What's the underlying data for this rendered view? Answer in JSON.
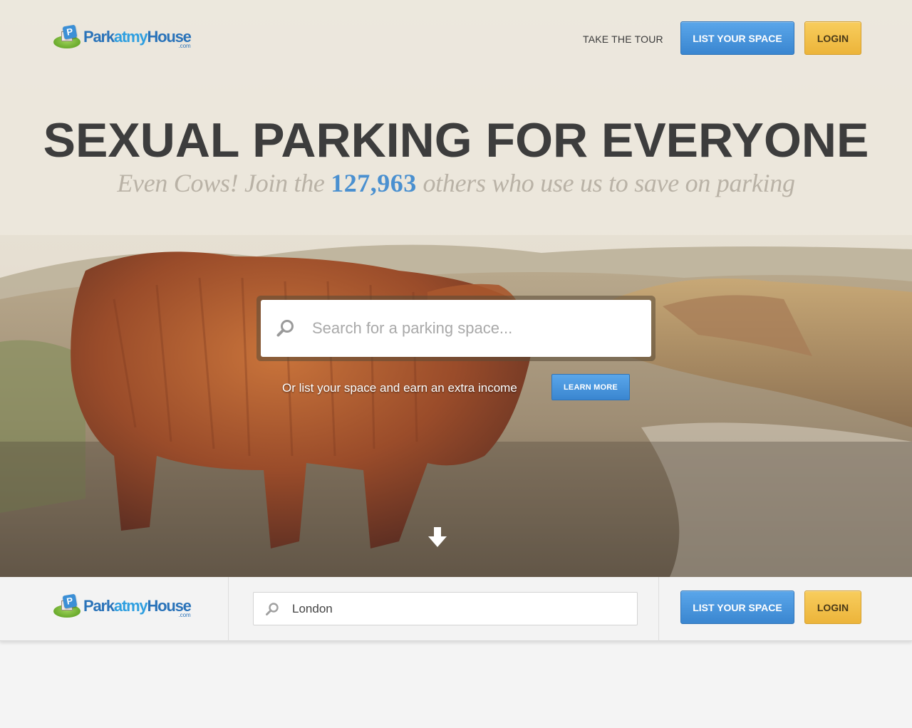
{
  "brand": {
    "logo_part1": "Park",
    "logo_part2": "atmy",
    "logo_part3": "House",
    "logo_suffix": ".com",
    "logo_badge": "P"
  },
  "nav": {
    "tour_label": "TAKE THE TOUR",
    "list_label": "LIST YOUR SPACE",
    "login_label": "LOGIN"
  },
  "hero": {
    "headline": "SEXUAL PARKING FOR EVERYONE",
    "sub_before": "Even Cows! Join the ",
    "sub_count": "127,963",
    "sub_after": " others who use us to save on parking",
    "search_placeholder": "Search for a parking space...",
    "promo_text": "Or list your space and earn an extra income",
    "learn_more_label": "LEARN MORE"
  },
  "sticky_bar": {
    "search_value": "London",
    "list_label": "LIST YOUR SPACE",
    "login_label": "LOGIN"
  },
  "colors": {
    "accent_blue": "#3a86d0",
    "accent_yellow": "#ecb43a",
    "headline": "#3d3d3d",
    "count_blue": "#4a90d0"
  },
  "icons": [
    "search-icon",
    "down-arrow-icon",
    "logo-icon"
  ]
}
